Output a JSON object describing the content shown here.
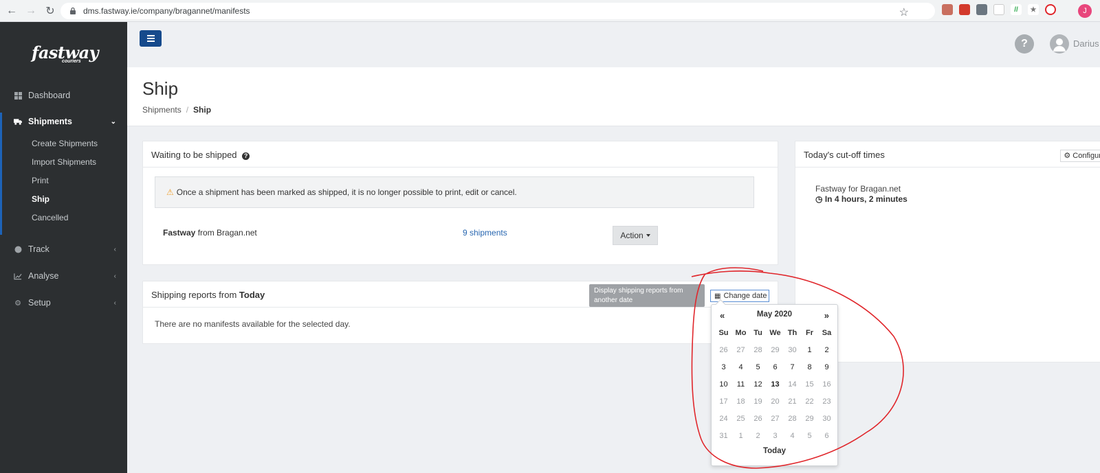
{
  "browser": {
    "url": "dms.fastway.ie/company/bragannet/manifests",
    "profile_initial": "J"
  },
  "brand": {
    "logo_main": "fastway",
    "logo_sub": "couriers"
  },
  "sidebar": {
    "items": [
      {
        "label": "Dashboard"
      },
      {
        "label": "Shipments"
      },
      {
        "label": "Track"
      },
      {
        "label": "Analyse"
      },
      {
        "label": "Setup"
      }
    ],
    "shipments_sub": [
      {
        "label": "Create Shipments"
      },
      {
        "label": "Import Shipments"
      },
      {
        "label": "Print"
      },
      {
        "label": "Ship"
      },
      {
        "label": "Cancelled"
      }
    ]
  },
  "header": {
    "help": "?",
    "username": "Darius"
  },
  "page": {
    "title": "Ship",
    "breadcrumb": [
      "Shipments",
      "/",
      "Ship"
    ]
  },
  "waiting_panel": {
    "title": "Waiting to be shipped",
    "warning": "Once a shipment has been marked as shipped, it is no longer possible to print, edit or cancel.",
    "carrier": "Fastway",
    "from_label": "from Bragan.net",
    "count": "9 shipments",
    "action_label": "Action"
  },
  "cutoff_panel": {
    "title": "Today's cut-off times",
    "configure_label": "Configure",
    "carrier": "Fastway for Bragan.net",
    "time": "In 4 hours, 2 minutes"
  },
  "reports_panel": {
    "title_prefix": "Shipping reports from",
    "title_day": "Today",
    "empty_text": "There are no manifests available for the selected day.",
    "tooltip": "Display shipping reports from another date",
    "change_date_label": "Change date"
  },
  "datepicker": {
    "prev": "«",
    "next": "»",
    "month_label": "May 2020",
    "weekdays": [
      "Su",
      "Mo",
      "Tu",
      "We",
      "Th",
      "Fr",
      "Sa"
    ],
    "weeks": [
      [
        "26",
        "27",
        "28",
        "29",
        "30",
        "1",
        "2"
      ],
      [
        "3",
        "4",
        "5",
        "6",
        "7",
        "8",
        "9"
      ],
      [
        "10",
        "11",
        "12",
        "13",
        "14",
        "15",
        "16"
      ],
      [
        "17",
        "18",
        "19",
        "20",
        "21",
        "22",
        "23"
      ],
      [
        "24",
        "25",
        "26",
        "27",
        "28",
        "29",
        "30"
      ],
      [
        "31",
        "1",
        "2",
        "3",
        "4",
        "5",
        "6"
      ]
    ],
    "selectable_range": [
      "1",
      "13"
    ],
    "current_day": "13",
    "today_label": "Today"
  },
  "colors": {
    "sidebar_bg": "#2c2f31",
    "brand_blue": "#164a8c",
    "link_blue": "#2766b0",
    "annotation_red": "#e0262b"
  }
}
